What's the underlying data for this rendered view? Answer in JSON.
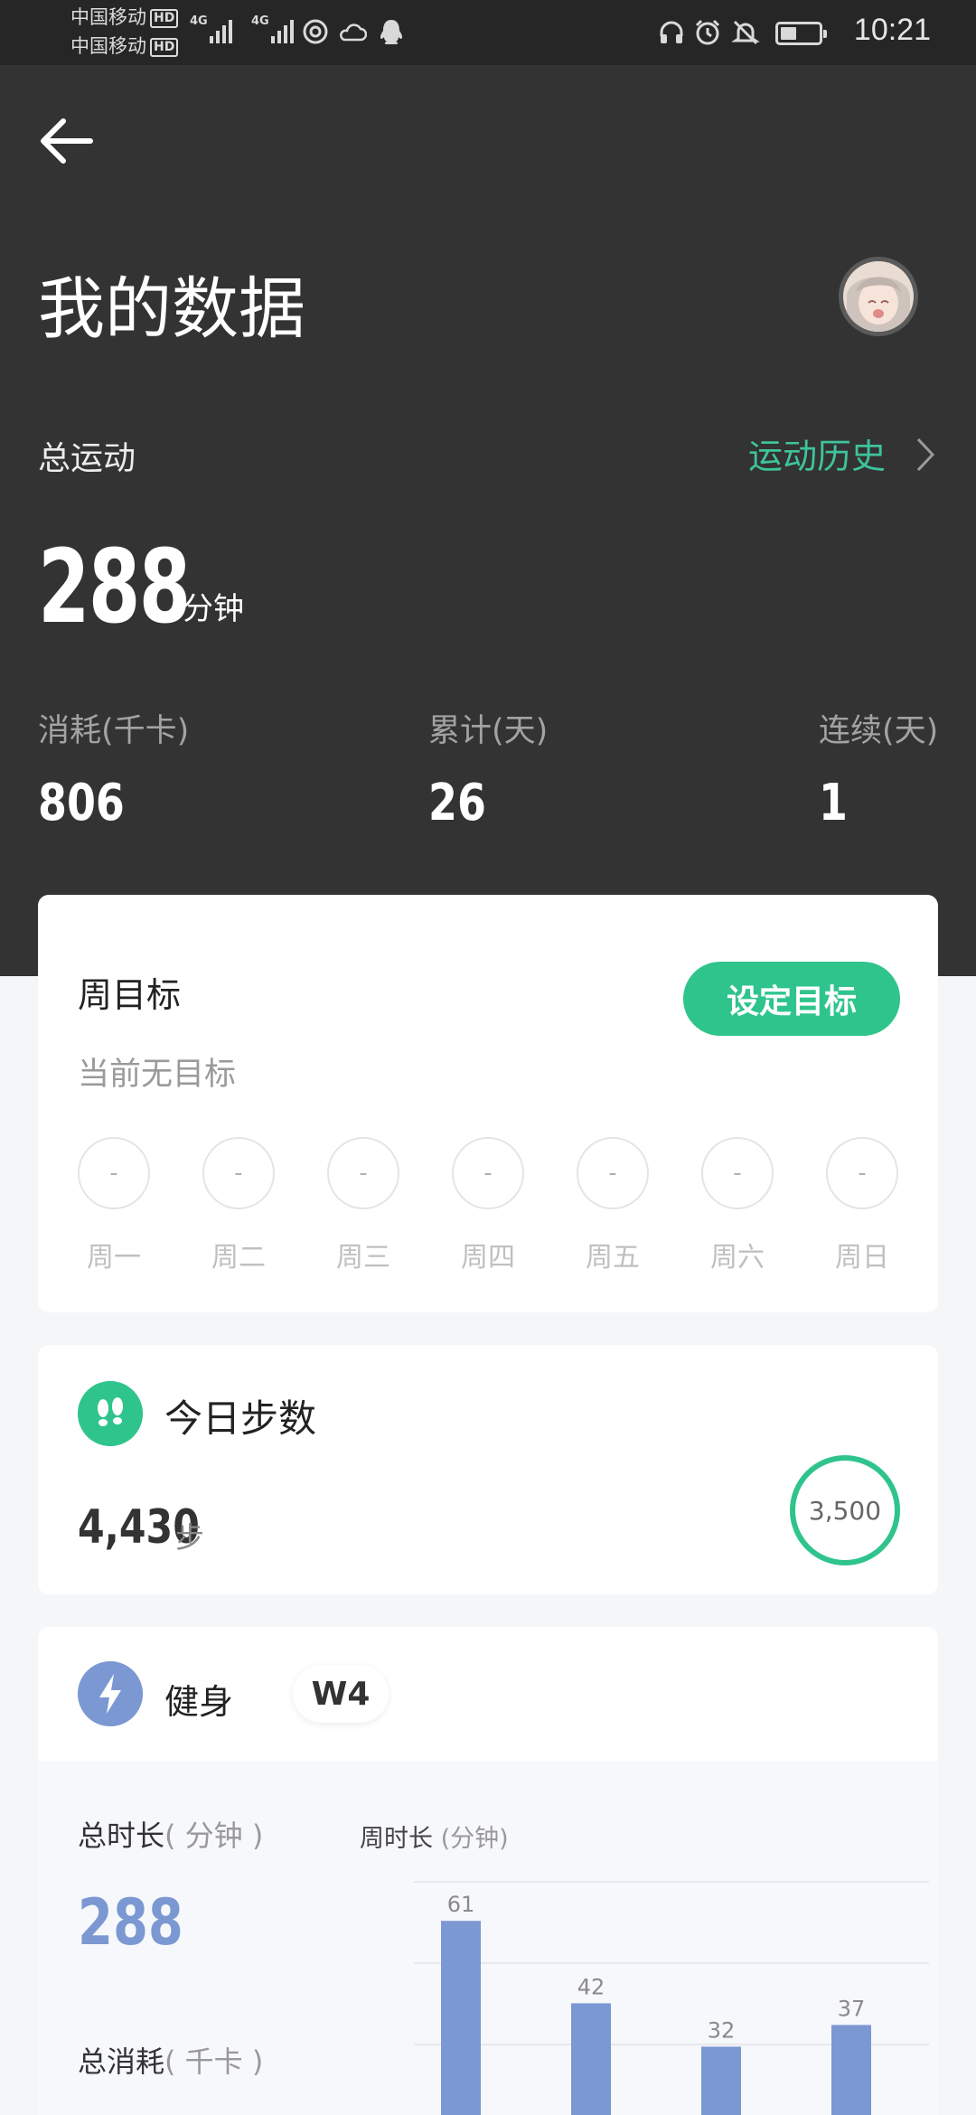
{
  "status_bar": {
    "carrier_1": "中国移动",
    "carrier_2": "中国移动",
    "hd": "HD",
    "network": "4G",
    "time": "10:21"
  },
  "header": {
    "title": "我的数据",
    "back_icon": "arrow-left-icon"
  },
  "summary": {
    "total_label": "总运动",
    "history_link": "运动历史",
    "total_minutes": "288",
    "total_unit": "分钟",
    "stats": [
      {
        "label": "消耗(千卡)",
        "value": "806"
      },
      {
        "label": "累计(天)",
        "value": "26"
      },
      {
        "label": "连续(天)",
        "value": "1"
      }
    ]
  },
  "weekly_goal": {
    "title": "周目标",
    "subtitle": "当前无目标",
    "button": "设定目标",
    "days": [
      {
        "label": "周一",
        "value": "-"
      },
      {
        "label": "周二",
        "value": "-"
      },
      {
        "label": "周三",
        "value": "-"
      },
      {
        "label": "周四",
        "value": "-"
      },
      {
        "label": "周五",
        "value": "-"
      },
      {
        "label": "周六",
        "value": "-"
      },
      {
        "label": "周日",
        "value": "-"
      }
    ]
  },
  "steps": {
    "title": "今日步数",
    "value": "4,430",
    "unit": "步",
    "goal": "3,500"
  },
  "fitness": {
    "title": "健身",
    "week_badge": "W4",
    "total_duration_label": "总时长",
    "total_duration_unit": "( 分钟 )",
    "total_duration_value": "288",
    "total_calories_label": "总消耗",
    "total_calories_unit": "( 千卡 )",
    "chart_title": "周时长",
    "chart_unit": "(分钟)"
  },
  "colors": {
    "accent_green": "#2fc48c",
    "link_green": "#3ec39a",
    "fitness_blue": "#7b98d2",
    "dark_bg": "#333333"
  },
  "chart_data": {
    "type": "bar",
    "title": "周时长 (分钟)",
    "values": [
      61,
      42,
      32,
      37
    ],
    "ylim": [
      0,
      70
    ],
    "grid": true
  }
}
